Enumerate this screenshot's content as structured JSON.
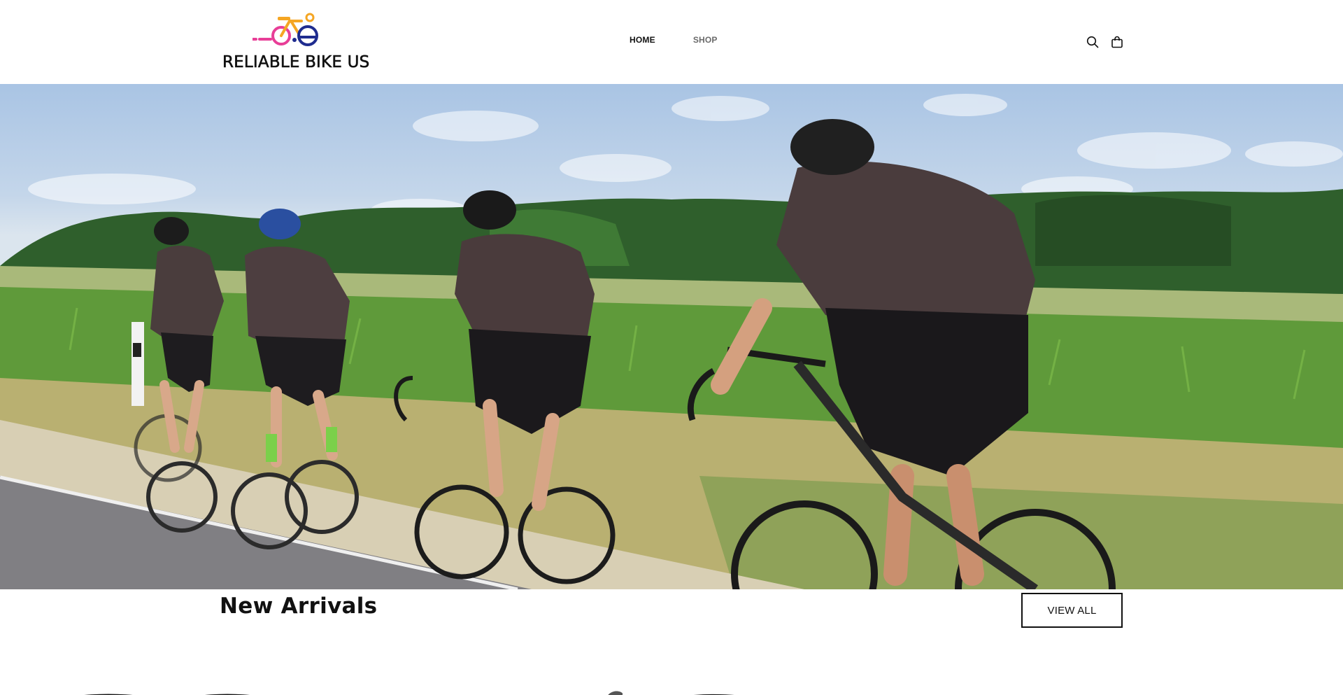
{
  "header": {
    "brand_name": "RELIABLE BIKE US",
    "logo_icon": "bicycle-logo-icon",
    "nav": [
      {
        "label": "HOME",
        "active": true
      },
      {
        "label": "SHOP",
        "active": false
      }
    ],
    "icons": {
      "search": "search-icon",
      "cart": "shopping-bag-icon"
    }
  },
  "hero": {
    "image": "road-cyclists-photo"
  },
  "new_arrivals": {
    "title": "New Arrivals",
    "view_all_label": "VIEW ALL"
  },
  "colors": {
    "logo_pink": "#e83e97",
    "logo_orange": "#f5a623",
    "logo_navy": "#1f2c8f",
    "text": "#111111",
    "nav_muted": "#6a6a6a"
  }
}
